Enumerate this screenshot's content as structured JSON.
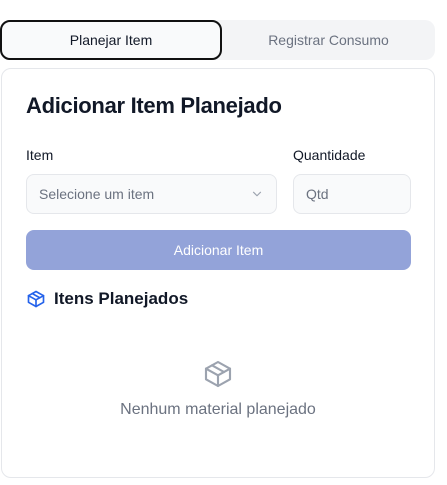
{
  "tabs": [
    {
      "label": "Planejar Item",
      "active": true
    },
    {
      "label": "Registrar Consumo",
      "active": false
    }
  ],
  "card": {
    "title": "Adicionar Item Planejado",
    "item_label": "Item",
    "item_select_placeholder": "Selecione um item",
    "quantity_label": "Quantidade",
    "quantity_placeholder": "Qtd",
    "add_button_label": "Adicionar Item",
    "section_title": "Itens Planejados",
    "empty_message": "Nenhum material planejado"
  },
  "icons": {
    "select_chevron": "chevron-down-icon",
    "section_icon": "package-icon",
    "empty_icon": "package-icon"
  },
  "colors": {
    "accent_disabled": "#93a3d9",
    "section_icon": "#2563eb",
    "muted_text": "#6b7280"
  }
}
